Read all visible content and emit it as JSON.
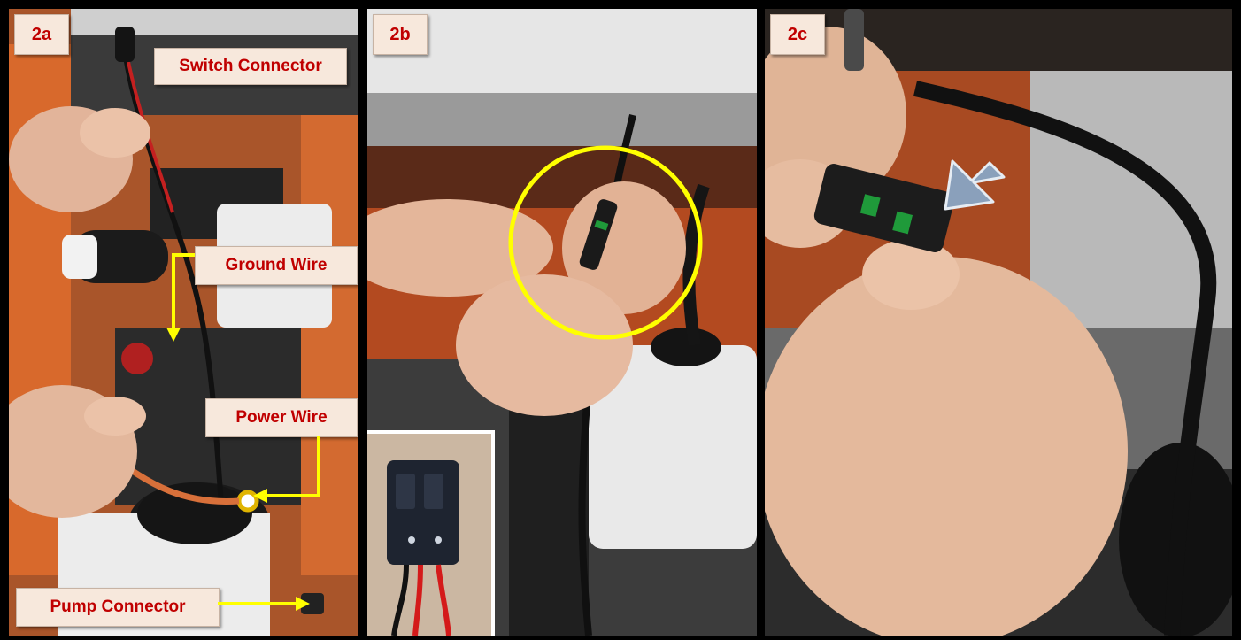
{
  "panels": [
    {
      "step": "2a"
    },
    {
      "step": "2b"
    },
    {
      "step": "2c"
    }
  ],
  "callouts": {
    "switch_connector": "Switch Connector",
    "ground_wire": "Ground Wire",
    "power_wire": "Power Wire",
    "pump_connector": "Pump Connector"
  },
  "colors": {
    "label_text": "#c00000",
    "label_background": "#f7e8dc",
    "pointer_arrow": "#ffff00",
    "highlight_circle": "#ffff00",
    "direction_arrow": "#8aa0bb",
    "frame": "#000000"
  },
  "icons": {
    "pointer": "yellow-elbow-arrow",
    "highlight": "yellow-circle",
    "direction": "blue-grey-arrow"
  }
}
